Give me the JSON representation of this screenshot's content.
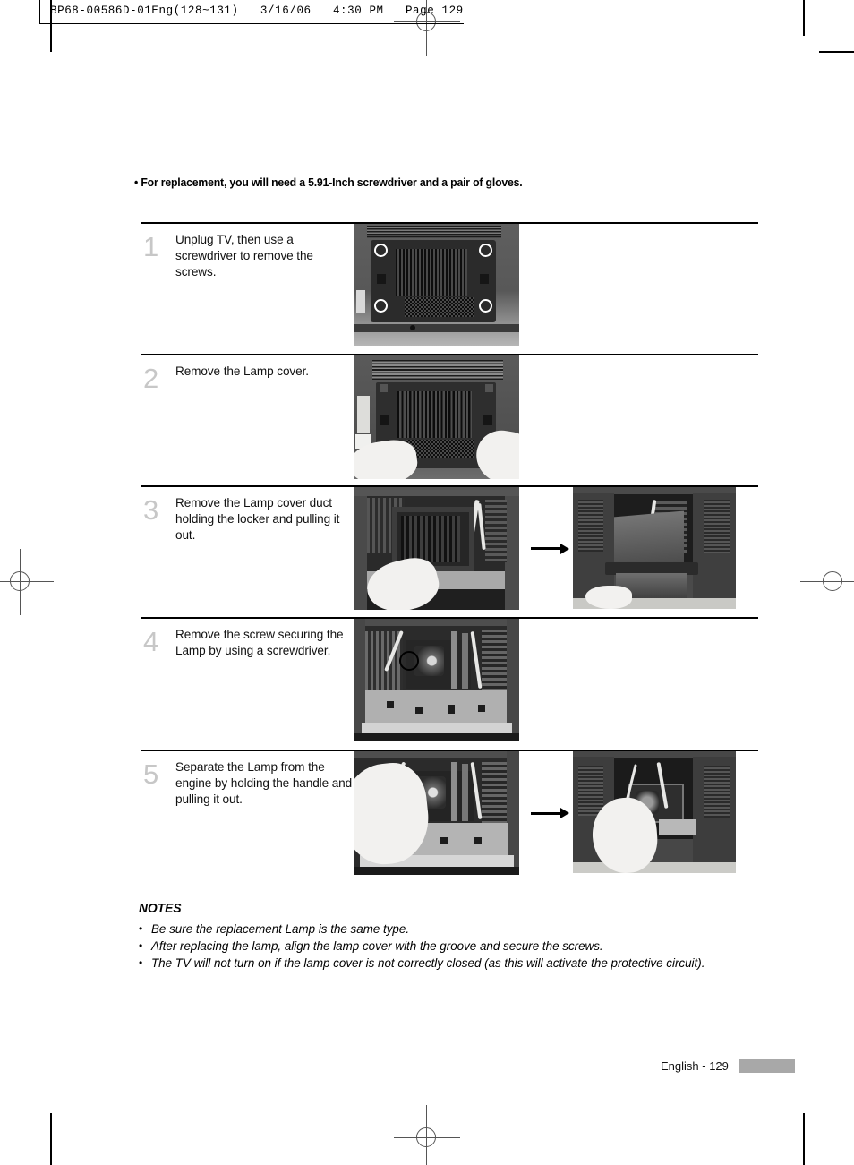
{
  "print_header": {
    "text": "BP68-00586D-01Eng(128~131)   3/16/06   4:30 PM   Page 129"
  },
  "intro": {
    "text": "• For replacement, you will need a 5.91-Inch screwdriver and a pair of gloves."
  },
  "steps": [
    {
      "number": "1",
      "text": "Unplug TV, then use a screwdriver to remove the screws.",
      "images": [
        {
          "caption": "tv-rear-panel-with-four-highlighted-screws"
        }
      ],
      "arrow": false
    },
    {
      "number": "2",
      "text": "Remove the Lamp cover.",
      "images": [
        {
          "caption": "gloved-hands-removing-lamp-cover"
        }
      ],
      "arrow": false
    },
    {
      "number": "3",
      "text": "Remove the Lamp cover duct holding the locker and pulling it out.",
      "images": [
        {
          "caption": "gloved-hand-gripping-lamp-cover-duct-locker"
        },
        {
          "caption": "lamp-cover-duct-pulled-out-of-tv"
        }
      ],
      "arrow": true
    },
    {
      "number": "4",
      "text": "Remove the screw securing the Lamp by using a screwdriver.",
      "images": [
        {
          "caption": "tv-interior-with-circled-lamp-screw"
        }
      ],
      "arrow": false
    },
    {
      "number": "5",
      "text": "Separate the Lamp from the engine by holding the handle and pulling it out.",
      "images": [
        {
          "caption": "gloved-hand-holding-lamp-handle-inside-engine"
        },
        {
          "caption": "lamp-removed-from-engine-held-by-gloved-hand"
        }
      ],
      "arrow": true
    }
  ],
  "notes": {
    "title": "NOTES",
    "bullet": "•",
    "items": [
      "Be sure the replacement Lamp is the same type.",
      "After replacing the lamp, align the lamp cover with the groove and secure the screws.",
      "The TV will not turn on if the lamp cover is not correctly closed (as this will activate the protective circuit)."
    ]
  },
  "footer": {
    "page_label": "English - 129"
  },
  "colors": {
    "step_number": "#c7c7c7",
    "rule": "#000000",
    "footer_bar": "#a8a8a8",
    "highlight_ring": "#ffffff"
  }
}
